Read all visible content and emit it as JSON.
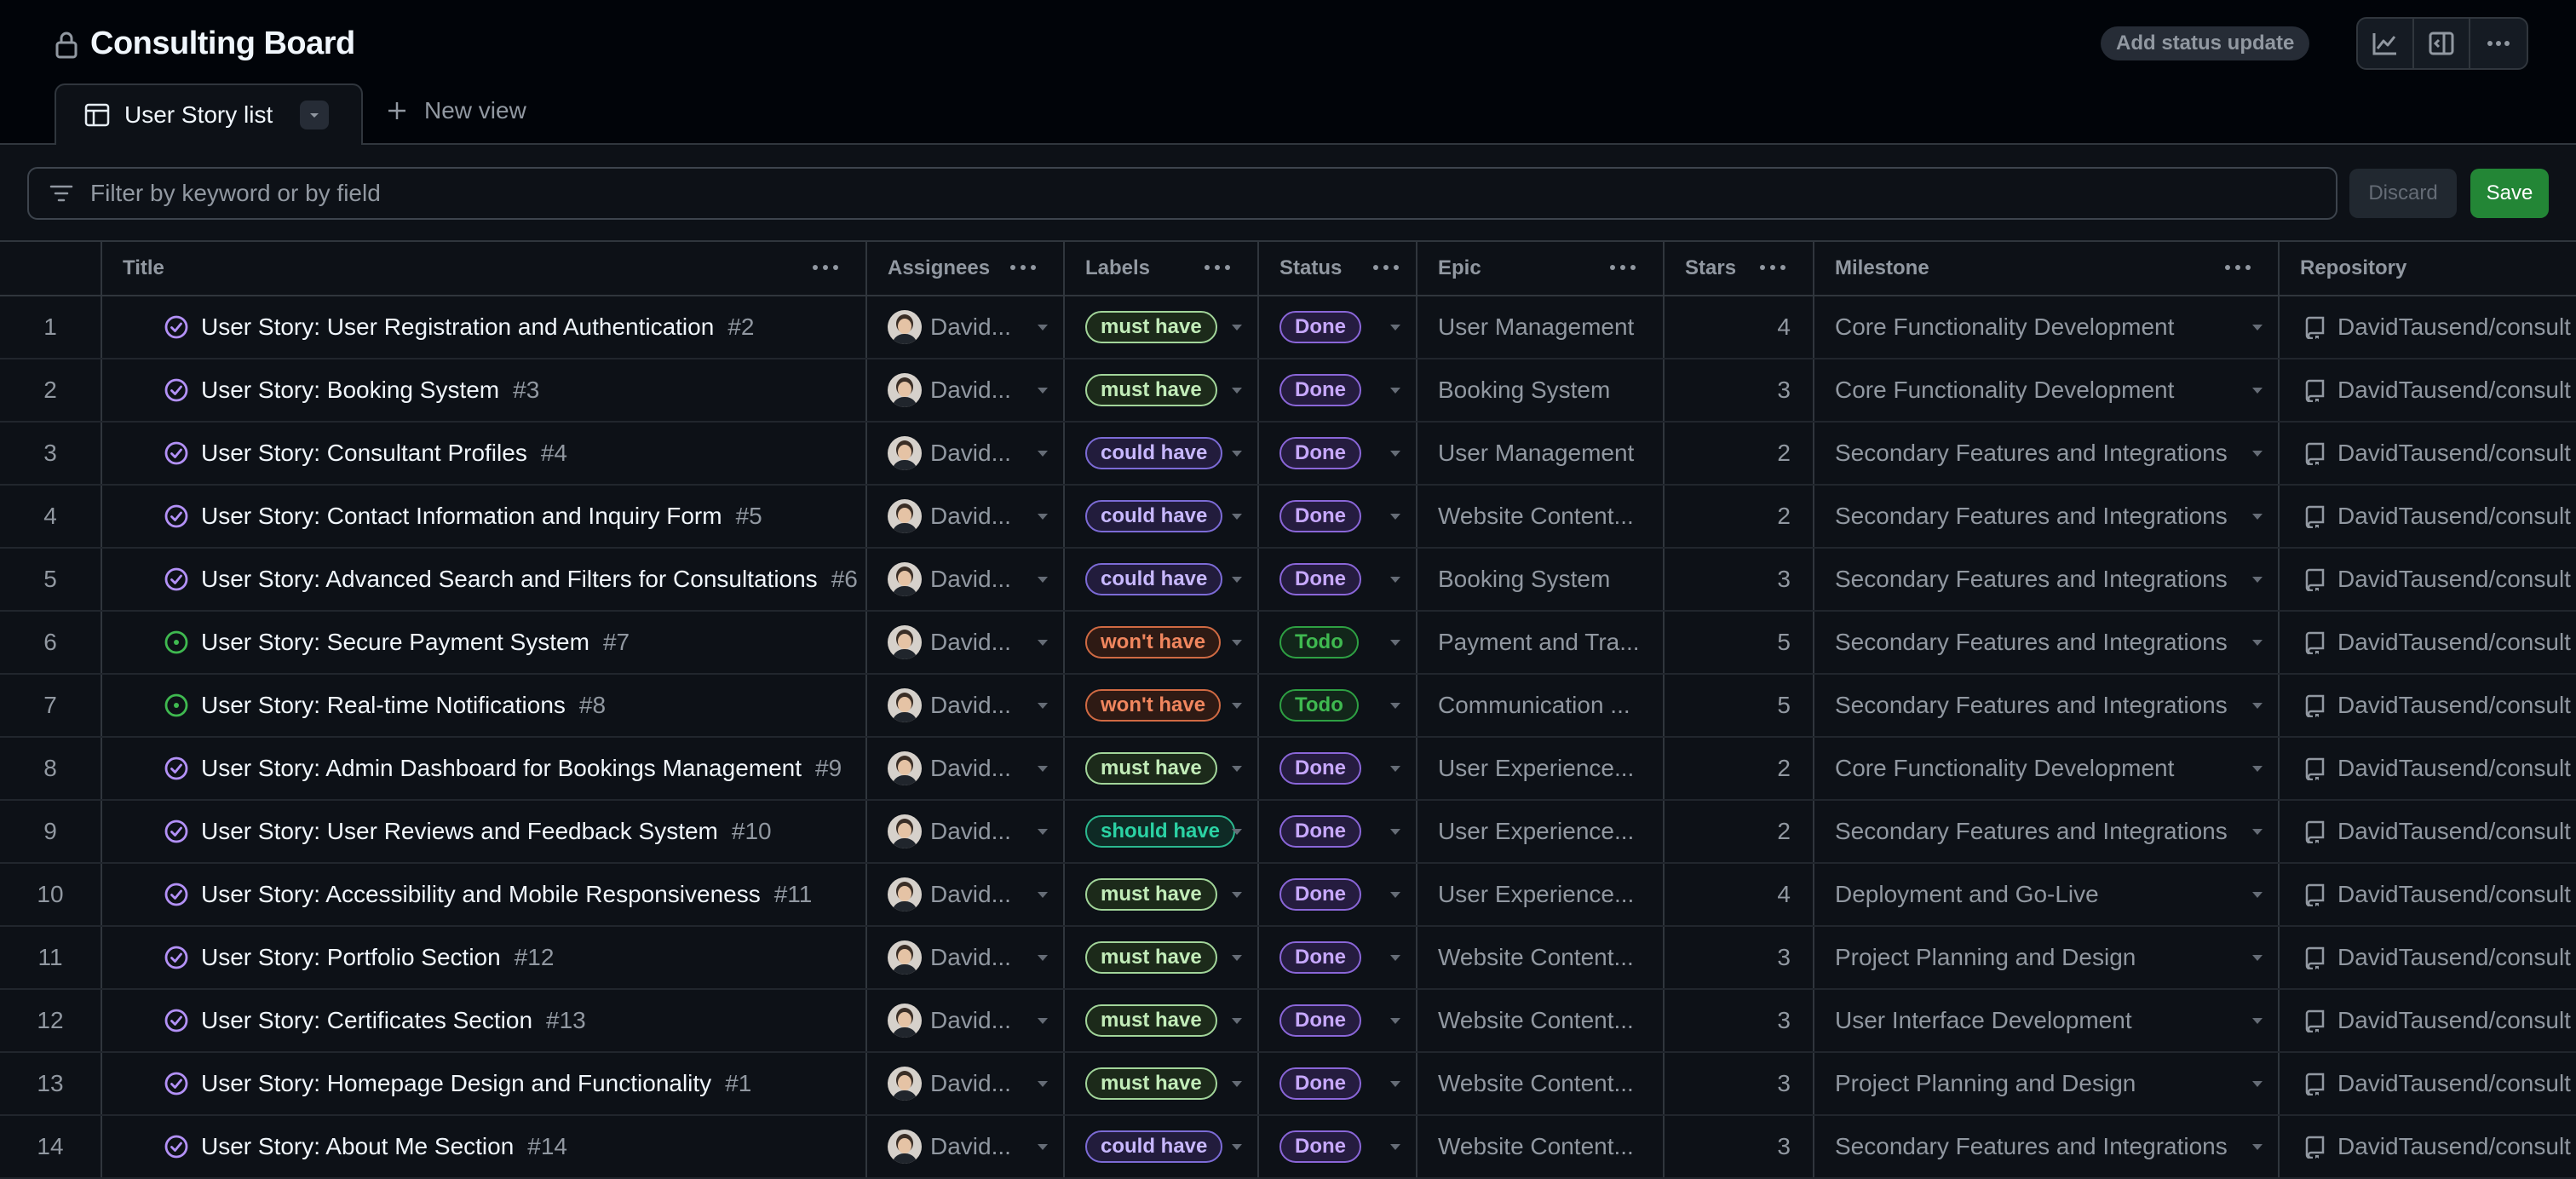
{
  "header": {
    "title": "Consulting Board",
    "status_button": "Add status update"
  },
  "tabs": {
    "active_label": "User Story list",
    "new_view_label": "New view"
  },
  "filter": {
    "placeholder": "Filter by keyword or by field",
    "value": "",
    "discard_label": "Discard",
    "save_label": "Save"
  },
  "columns": [
    "Title",
    "Assignees",
    "Labels",
    "Status",
    "Epic",
    "Stars",
    "Milestone",
    "Repository"
  ],
  "colors": {
    "must_have": "#a2d59a",
    "could_have": "#b39df8",
    "wont_have": "#f0865e",
    "should_have": "#2bd2a4",
    "done": "#b391f7",
    "todo": "#3fb950",
    "save": "#238636"
  },
  "rows": [
    {
      "num": "1",
      "state": "done",
      "title": "User Story: User Registration and Authentication",
      "issue": "#2",
      "assignee": "David...",
      "label": "must have",
      "label_type": "must",
      "status": "Done",
      "epic": "User Management",
      "stars": "4",
      "milestone": "Core Functionality Development",
      "repo": "DavidTausend/consult"
    },
    {
      "num": "2",
      "state": "done",
      "title": "User Story: Booking System",
      "issue": "#3",
      "assignee": "David...",
      "label": "must have",
      "label_type": "must",
      "status": "Done",
      "epic": "Booking System",
      "stars": "3",
      "milestone": "Core Functionality Development",
      "repo": "DavidTausend/consult"
    },
    {
      "num": "3",
      "state": "done",
      "title": "User Story: Consultant Profiles",
      "issue": "#4",
      "assignee": "David...",
      "label": "could have",
      "label_type": "could",
      "status": "Done",
      "epic": "User Management",
      "stars": "2",
      "milestone": "Secondary Features and Integrations",
      "repo": "DavidTausend/consult"
    },
    {
      "num": "4",
      "state": "done",
      "title": "User Story: Contact Information and Inquiry Form",
      "issue": "#5",
      "assignee": "David...",
      "label": "could have",
      "label_type": "could",
      "status": "Done",
      "epic": "Website Content...",
      "stars": "2",
      "milestone": "Secondary Features and Integrations",
      "repo": "DavidTausend/consult"
    },
    {
      "num": "5",
      "state": "done",
      "title": "User Story: Advanced Search and Filters for Consultations",
      "issue": "#6",
      "assignee": "David...",
      "label": "could have",
      "label_type": "could",
      "status": "Done",
      "epic": "Booking System",
      "stars": "3",
      "milestone": "Secondary Features and Integrations",
      "repo": "DavidTausend/consult"
    },
    {
      "num": "6",
      "state": "open",
      "title": "User Story: Secure Payment System",
      "issue": "#7",
      "assignee": "David...",
      "label": "won't have",
      "label_type": "wont",
      "status": "Todo",
      "epic": "Payment and Tra...",
      "stars": "5",
      "milestone": "Secondary Features and Integrations",
      "repo": "DavidTausend/consult"
    },
    {
      "num": "7",
      "state": "open",
      "title": "User Story: Real-time Notifications",
      "issue": "#8",
      "assignee": "David...",
      "label": "won't have",
      "label_type": "wont",
      "status": "Todo",
      "epic": "Communication ...",
      "stars": "5",
      "milestone": "Secondary Features and Integrations",
      "repo": "DavidTausend/consult"
    },
    {
      "num": "8",
      "state": "done",
      "title": "User Story: Admin Dashboard for Bookings Management",
      "issue": "#9",
      "assignee": "David...",
      "label": "must have",
      "label_type": "must",
      "status": "Done",
      "epic": "User Experience...",
      "stars": "2",
      "milestone": "Core Functionality Development",
      "repo": "DavidTausend/consult"
    },
    {
      "num": "9",
      "state": "done",
      "title": "User Story: User Reviews and Feedback System",
      "issue": "#10",
      "assignee": "David...",
      "label": "should have",
      "label_type": "should",
      "status": "Done",
      "epic": "User Experience...",
      "stars": "2",
      "milestone": "Secondary Features and Integrations",
      "repo": "DavidTausend/consult"
    },
    {
      "num": "10",
      "state": "done",
      "title": "User Story: Accessibility and Mobile Responsiveness",
      "issue": "#11",
      "assignee": "David...",
      "label": "must have",
      "label_type": "must",
      "status": "Done",
      "epic": "User Experience...",
      "stars": "4",
      "milestone": "Deployment and Go-Live",
      "repo": "DavidTausend/consult"
    },
    {
      "num": "11",
      "state": "done",
      "title": "User Story: Portfolio Section",
      "issue": "#12",
      "assignee": "David...",
      "label": "must have",
      "label_type": "must",
      "status": "Done",
      "epic": "Website Content...",
      "stars": "3",
      "milestone": "Project Planning and Design",
      "repo": "DavidTausend/consult"
    },
    {
      "num": "12",
      "state": "done",
      "title": "User Story: Certificates Section",
      "issue": "#13",
      "assignee": "David...",
      "label": "must have",
      "label_type": "must",
      "status": "Done",
      "epic": "Website Content...",
      "stars": "3",
      "milestone": "User Interface Development",
      "repo": "DavidTausend/consult"
    },
    {
      "num": "13",
      "state": "done",
      "title": "User Story: Homepage Design and Functionality",
      "issue": "#1",
      "assignee": "David...",
      "label": "must have",
      "label_type": "must",
      "status": "Done",
      "epic": "Website Content...",
      "stars": "3",
      "milestone": "Project Planning and Design",
      "repo": "DavidTausend/consult"
    },
    {
      "num": "14",
      "state": "done",
      "title": "User Story: About Me Section",
      "issue": "#14",
      "assignee": "David...",
      "label": "could have",
      "label_type": "could",
      "status": "Done",
      "epic": "Website Content...",
      "stars": "3",
      "milestone": "Secondary Features and Integrations",
      "repo": "DavidTausend/consult"
    }
  ]
}
